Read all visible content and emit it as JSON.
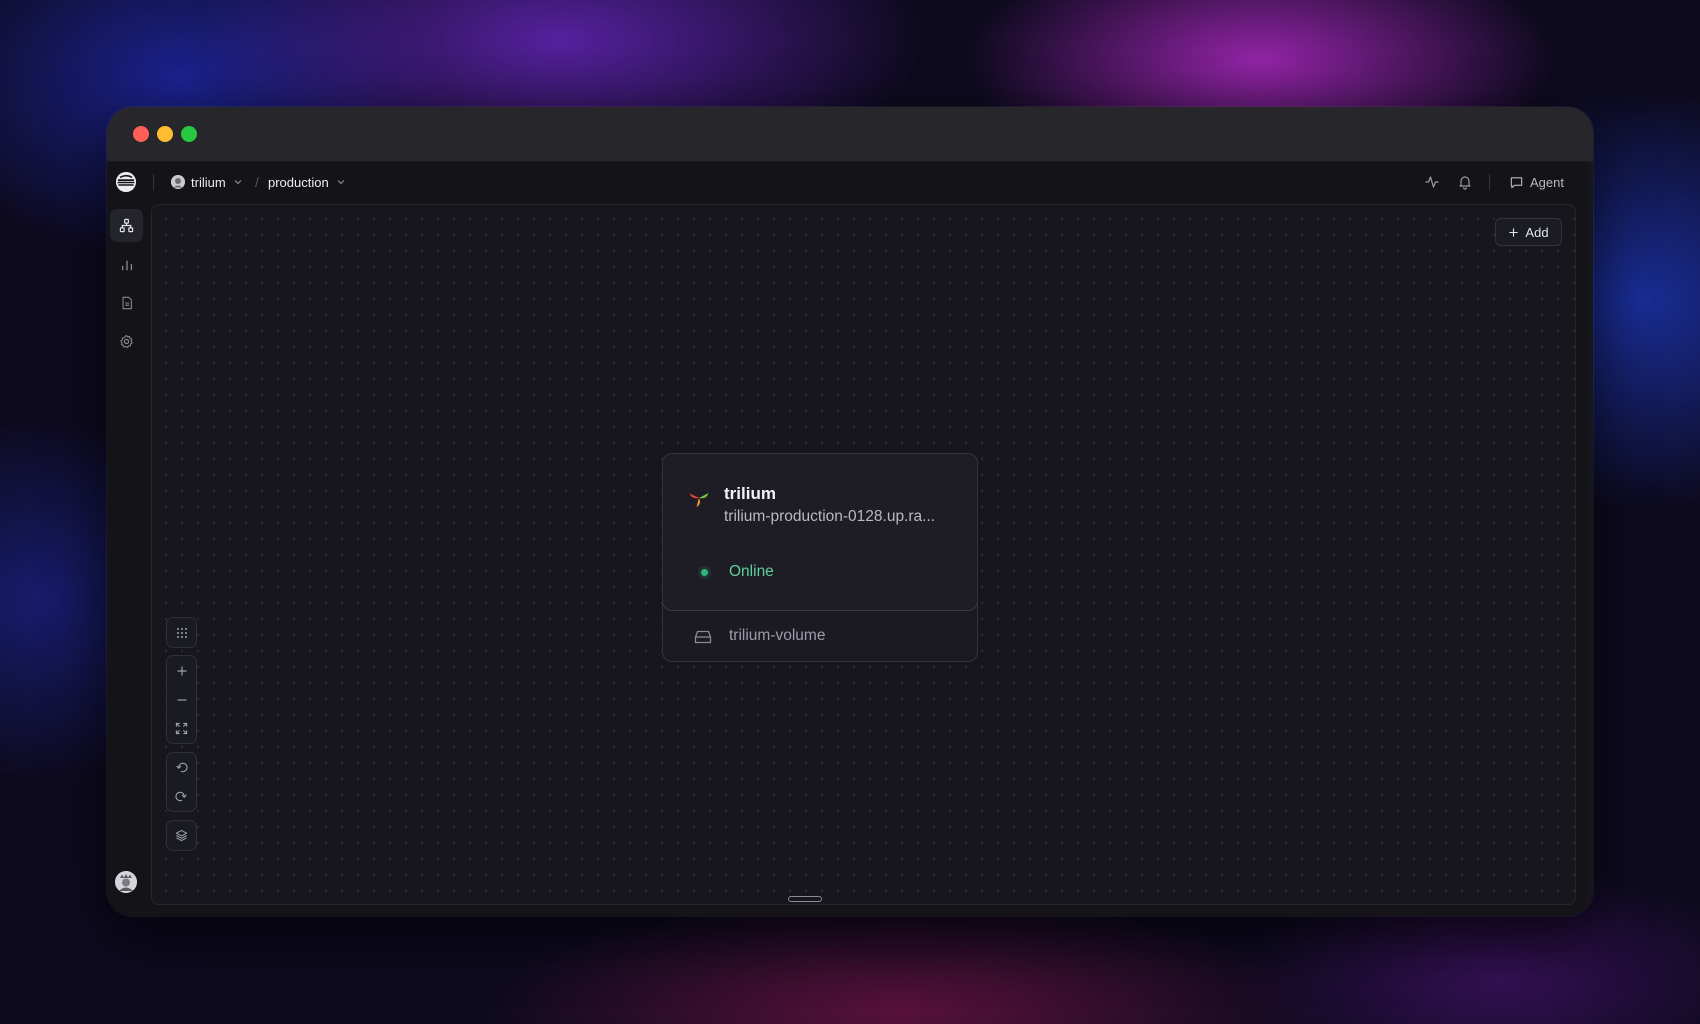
{
  "window": {
    "controls": [
      "close",
      "minimize",
      "maximize"
    ]
  },
  "topbar": {
    "logo_icon": "railway-logo-icon",
    "project": {
      "name": "trilium",
      "icon": "avatar-icon"
    },
    "environment": {
      "name": "production"
    },
    "breadcrumb_separator": "/",
    "right_icons": [
      "activity-icon",
      "bell-icon"
    ],
    "agent_label": "Agent"
  },
  "sidebar": {
    "items": [
      {
        "name": "architecture",
        "icon": "architecture-icon",
        "active": true
      },
      {
        "name": "metrics",
        "icon": "bar-chart-icon",
        "active": false
      },
      {
        "name": "logs",
        "icon": "document-icon",
        "active": false
      },
      {
        "name": "settings",
        "icon": "gear-icon",
        "active": false
      }
    ],
    "user_avatar": "user-avatar-icon"
  },
  "canvas": {
    "add_label": "Add",
    "service": {
      "name": "trilium",
      "url": "trilium-production-0128.up.ra...",
      "status": "Online",
      "volume": "trilium-volume",
      "colors": {
        "status": "#2fb47c"
      }
    },
    "controls": {
      "grid": "grid-icon",
      "zoom_in": "plus-icon",
      "zoom_out": "minus-icon",
      "fit": "fit-view-icon",
      "undo": "undo-icon",
      "redo": "redo-icon",
      "layers": "layers-icon"
    }
  }
}
